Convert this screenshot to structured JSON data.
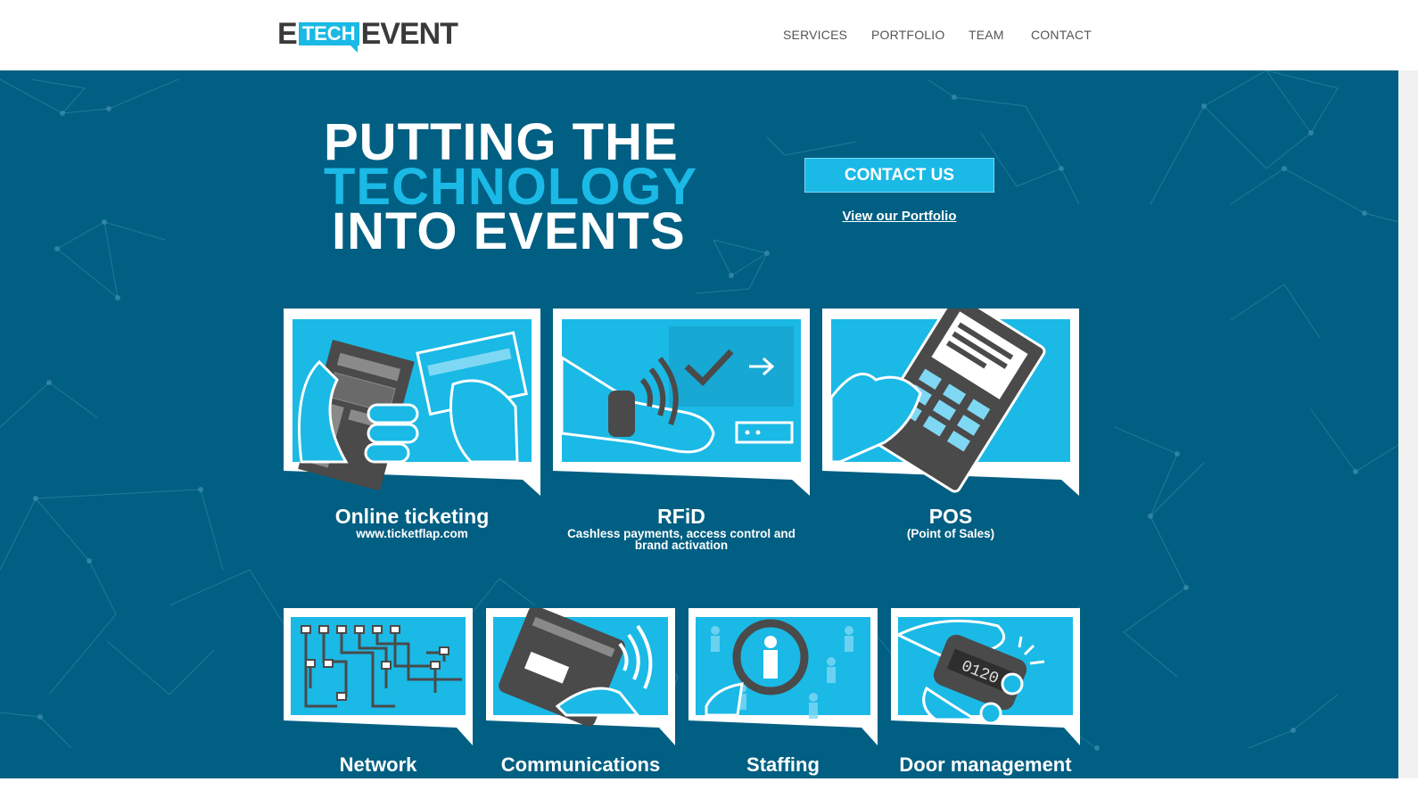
{
  "header": {
    "logo": {
      "e": "E",
      "tech": "TECH",
      "event": "EVENT"
    },
    "nav": [
      "SERVICES",
      "PORTFOLIO",
      "TEAM",
      "CONTACT"
    ]
  },
  "hero": {
    "headline": [
      "PUTTING THE",
      "TECHNOLOGY",
      "INTO EVENTS"
    ],
    "cta_label": "CONTACT US",
    "portfolio_link": "View our Portfolio"
  },
  "services_top": [
    {
      "title": "Online ticketing",
      "subtitle": "www.ticketflap.com",
      "icon": "ticket-card-icon"
    },
    {
      "title": "RFiD",
      "subtitle": "Cashless payments, access control and brand activation",
      "icon": "rfid-wristband-icon"
    },
    {
      "title": "POS",
      "subtitle": "(Point of Sales)",
      "icon": "pos-terminal-icon"
    }
  ],
  "services_bottom": [
    {
      "title": "Network",
      "icon": "network-icon"
    },
    {
      "title": "Communications",
      "icon": "phone-signal-icon"
    },
    {
      "title": "Staffing",
      "icon": "magnifier-person-icon"
    },
    {
      "title": "Door management",
      "icon": "clicker-counter-icon"
    }
  ],
  "counter_display": "0120",
  "colors": {
    "brand_blue": "#1ab9e6",
    "hero_bg": "#005f82",
    "dark_gray": "#4a4a4a",
    "nav_text": "#555555"
  }
}
